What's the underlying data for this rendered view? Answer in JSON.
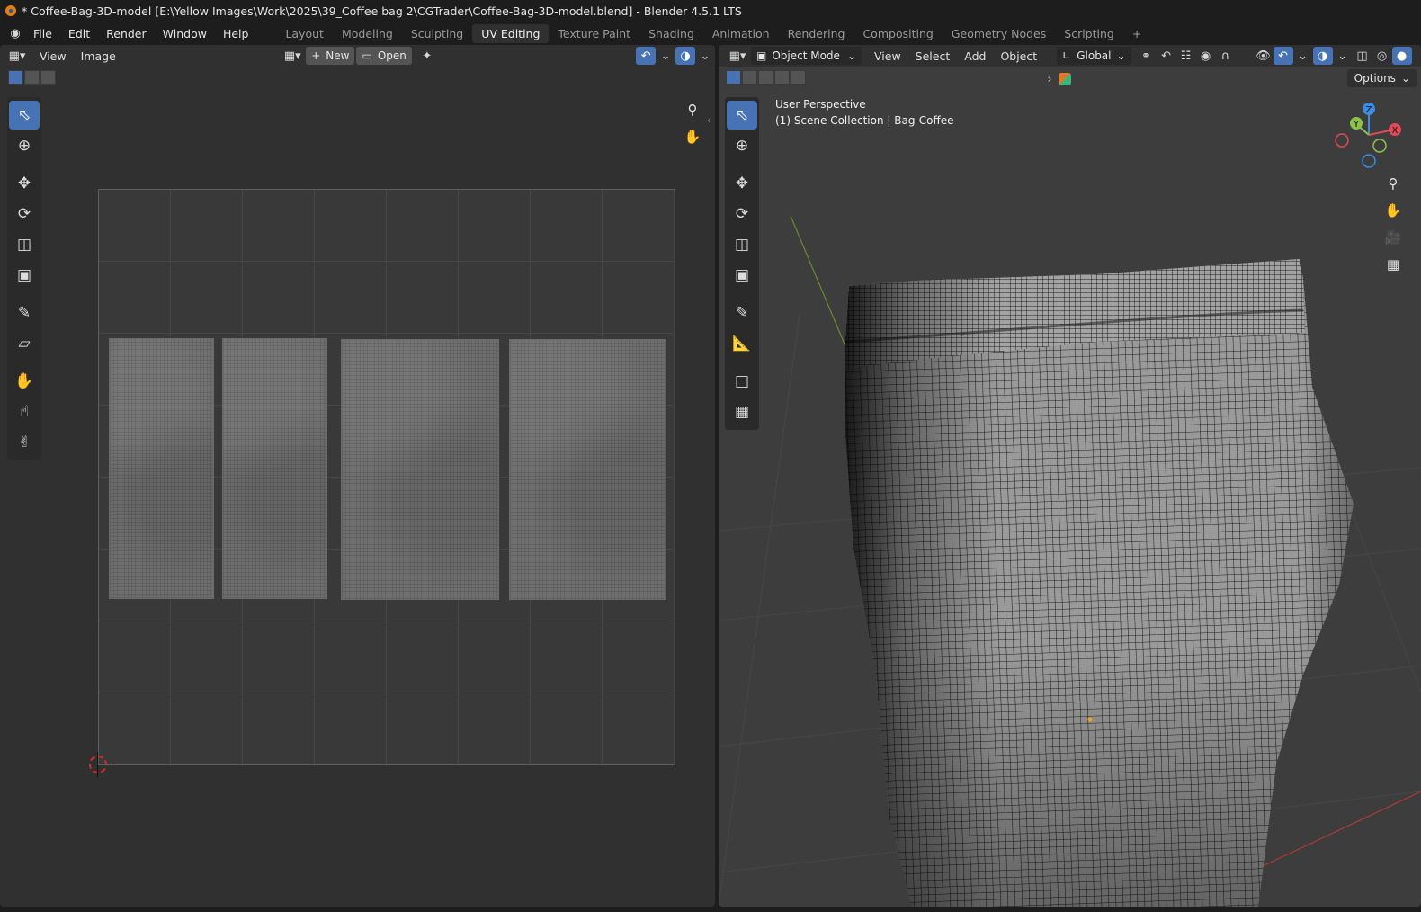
{
  "window": {
    "title": "* Coffee-Bag-3D-model [E:\\Yellow Images\\Work\\2025\\39_Coffee bag 2\\CGTrader\\Coffee-Bag-3D-model.blend] - Blender 4.5.1 LTS"
  },
  "menubar": {
    "items": [
      "File",
      "Edit",
      "Render",
      "Window",
      "Help"
    ],
    "workspaces": [
      "Layout",
      "Modeling",
      "Sculpting",
      "UV Editing",
      "Texture Paint",
      "Shading",
      "Animation",
      "Rendering",
      "Compositing",
      "Geometry Nodes",
      "Scripting"
    ],
    "active_workspace": "UV Editing",
    "add_tab": "+"
  },
  "uv_editor": {
    "menus": [
      "View",
      "Image"
    ],
    "new_label": "New",
    "open_label": "Open",
    "new_icon": "plus-icon",
    "open_icon": "folder-icon",
    "pin_icon": "pin-icon",
    "tools": [
      "select-box-icon",
      "cursor-icon",
      "move-icon",
      "rotate-icon",
      "scale-icon",
      "transform-icon",
      "annotate-icon",
      "rip-icon",
      "grab-icon",
      "relax-icon",
      "pinch-icon"
    ],
    "islands": 4
  },
  "viewport": {
    "mode_label": "Object Mode",
    "menus": [
      "View",
      "Select",
      "Add",
      "Object"
    ],
    "orientation_label": "Global",
    "options_label": "Options",
    "overlay_line1": "User Perspective",
    "overlay_line2": "(1) Scene Collection | Bag-Coffee",
    "axes": {
      "x": "X",
      "y": "Y",
      "z": "Z"
    },
    "tools": [
      "select-box-icon",
      "cursor-icon",
      "move-icon",
      "rotate-icon",
      "scale-icon",
      "transform-icon",
      "annotate-icon",
      "measure-icon",
      "add-cube-icon",
      "extrude-icon"
    ],
    "colors": {
      "x_axis": "#e04a58",
      "y_axis": "#8bc34a",
      "z_axis": "#3b8de8",
      "accent": "#4772b3"
    }
  }
}
